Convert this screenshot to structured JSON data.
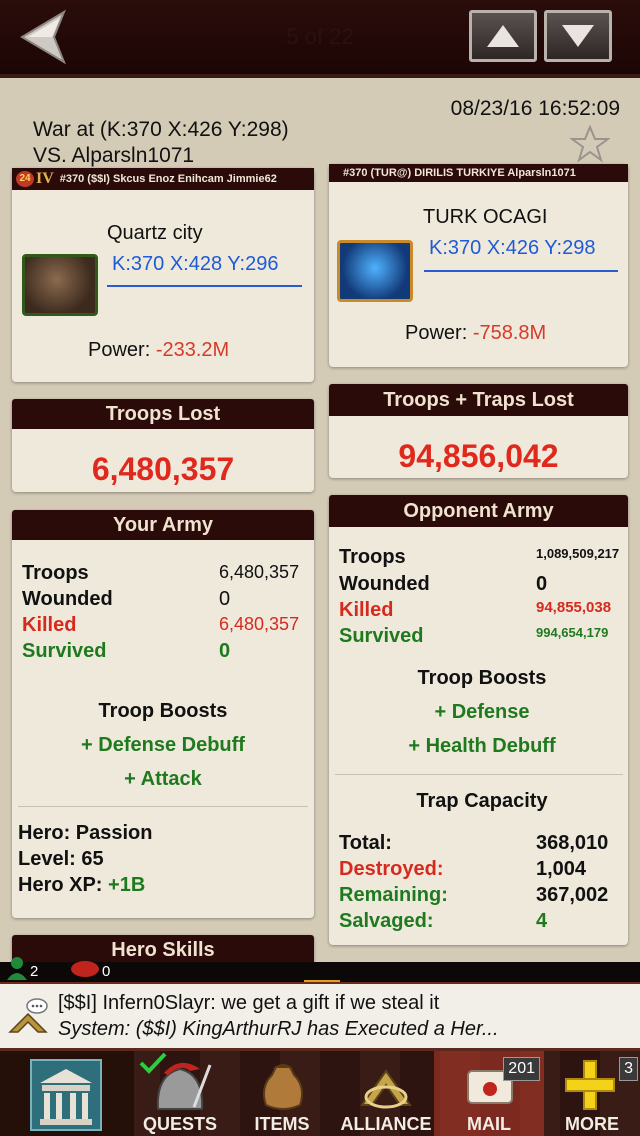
{
  "topbar": {
    "pager": "5 of 22"
  },
  "header": {
    "date": "08/23/16 16:52:09",
    "war_line": "War at (K:370 X:426 Y:298)",
    "vs_line": "VS. Alparsln1071"
  },
  "player": {
    "rank_badge": "24",
    "rank_roman": "IV",
    "strip_text": "#370 ($$I) Skcus Enoz Enihcam Jimmie62",
    "city": "Quartz city",
    "coords": "K:370 X:428 Y:296",
    "power_label": "Power:",
    "power_value": "-233.2M",
    "troops_lost_title": "Troops Lost",
    "troops_lost_value": "6,480,357",
    "army_title": "Your Army",
    "army": {
      "troops_label": "Troops",
      "troops_value": "6,480,357",
      "wounded_label": "Wounded",
      "wounded_value": "0",
      "killed_label": "Killed",
      "killed_value": "6,480,357",
      "survived_label": "Survived",
      "survived_value": "0"
    },
    "boosts_title": "Troop Boosts",
    "boosts": [
      "+ Defense Debuff",
      "+ Attack"
    ],
    "hero_name": "Hero: Passion",
    "hero_level": "Level: 65",
    "hero_xp_label": "Hero XP:",
    "hero_xp_value": "+1B",
    "skills_title": "Hero Skills"
  },
  "opponent": {
    "strip_text": "#370 (TUR@) DIRILIS TURKIYE Alparsln1071",
    "city": "TURK OCAGI",
    "coords": "K:370 X:426 Y:298",
    "power_label": "Power:",
    "power_value": "-758.8M",
    "lost_title": "Troops + Traps Lost",
    "lost_value": "94,856,042",
    "army_title": "Opponent Army",
    "army": {
      "troops_label": "Troops",
      "troops_value": "1,089,509,217",
      "wounded_label": "Wounded",
      "wounded_value": "0",
      "killed_label": "Killed",
      "killed_value": "94,855,038",
      "survived_label": "Survived",
      "survived_value": "994,654,179"
    },
    "boosts_title": "Troop Boosts",
    "boosts": [
      "+ Defense",
      "+ Health Debuff"
    ],
    "trap_title": "Trap Capacity",
    "trap": {
      "total_label": "Total:",
      "total_value": "368,010",
      "destroyed_label": "Destroyed:",
      "destroyed_value": "1,004",
      "remaining_label": "Remaining:",
      "remaining_value": "367,002",
      "salvaged_label": "Salvaged:",
      "salvaged_value": "4"
    }
  },
  "status": {
    "players_online": "2",
    "messages": "0"
  },
  "chat": {
    "line1": "[$$I] Infern0Slayr: we get a gift if we steal it",
    "line2": "System: ($$I) KingArthurRJ has Executed a Her..."
  },
  "nav": {
    "items": [
      {
        "label": "QUESTS"
      },
      {
        "label": "ITEMS"
      },
      {
        "label": "ALLIANCE"
      },
      {
        "label": "MAIL",
        "badge": "201"
      },
      {
        "label": "MORE",
        "badge": "3"
      }
    ]
  },
  "colors": {
    "accent_dark": "#2b0b09",
    "negative": "#d63b2a",
    "positive": "#1f7a1f",
    "link": "#1f5bd6"
  }
}
